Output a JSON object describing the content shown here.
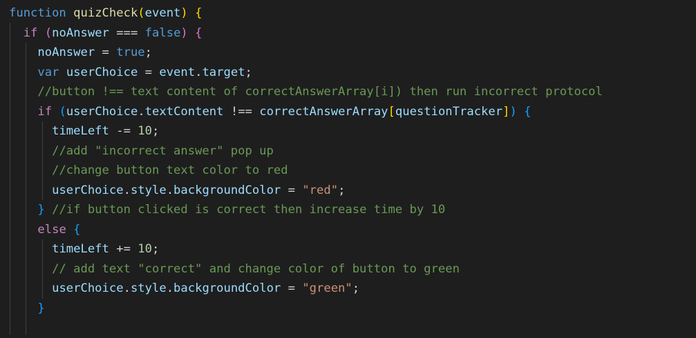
{
  "colors": {
    "background": "#1e1e1e",
    "default": "#d4d4d4",
    "keyword": "#569cd6",
    "control": "#c586c0",
    "function": "#dcdcaa",
    "variable": "#9cdcfe",
    "number": "#b5cea8",
    "string": "#ce9178",
    "comment": "#6a9955",
    "bracket_level1": "#ffd700",
    "bracket_level2": "#da70d6",
    "bracket_level3": "#179fff"
  },
  "lines": [
    [
      [
        "kw",
        "function"
      ],
      [
        "op",
        " "
      ],
      [
        "fn",
        "quizCheck"
      ],
      [
        "b1",
        "("
      ],
      [
        "var",
        "event"
      ],
      [
        "b1",
        ")"
      ],
      [
        "op",
        " "
      ],
      [
        "b1",
        "{"
      ]
    ],
    [
      [
        "op",
        "  "
      ],
      [
        "ctrl",
        "if"
      ],
      [
        "op",
        " "
      ],
      [
        "b2",
        "("
      ],
      [
        "var",
        "noAnswer"
      ],
      [
        "op",
        " === "
      ],
      [
        "kw",
        "false"
      ],
      [
        "b2",
        ")"
      ],
      [
        "op",
        " "
      ],
      [
        "b2",
        "{"
      ]
    ],
    [
      [
        "op",
        "    "
      ],
      [
        "var",
        "noAnswer"
      ],
      [
        "op",
        " = "
      ],
      [
        "kw",
        "true"
      ],
      [
        "op",
        ";"
      ]
    ],
    [
      [
        "op",
        "    "
      ],
      [
        "kw",
        "var"
      ],
      [
        "op",
        " "
      ],
      [
        "var",
        "userChoice"
      ],
      [
        "op",
        " = "
      ],
      [
        "var",
        "event"
      ],
      [
        "op",
        "."
      ],
      [
        "var",
        "target"
      ],
      [
        "op",
        ";"
      ]
    ],
    [
      [
        "op",
        "    "
      ],
      [
        "cmt",
        "//button !== text content of correctAnswerArray[i]) then run incorrect protocol"
      ]
    ],
    [
      [
        "op",
        "    "
      ],
      [
        "ctrl",
        "if"
      ],
      [
        "op",
        " "
      ],
      [
        "b3",
        "("
      ],
      [
        "var",
        "userChoice"
      ],
      [
        "op",
        "."
      ],
      [
        "var",
        "textContent"
      ],
      [
        "op",
        " !== "
      ],
      [
        "var",
        "correctAnswerArray"
      ],
      [
        "b1",
        "["
      ],
      [
        "var",
        "questionTracker"
      ],
      [
        "b1",
        "]"
      ],
      [
        "b3",
        ")"
      ],
      [
        "op",
        " "
      ],
      [
        "b3",
        "{"
      ]
    ],
    [
      [
        "op",
        "      "
      ],
      [
        "var",
        "timeLeft"
      ],
      [
        "op",
        " -= "
      ],
      [
        "num",
        "10"
      ],
      [
        "op",
        ";"
      ]
    ],
    [
      [
        "op",
        "      "
      ],
      [
        "cmt",
        "//add \"incorrect answer\" pop up"
      ]
    ],
    [
      [
        "op",
        "      "
      ],
      [
        "cmt",
        "//change button text color to red"
      ]
    ],
    [
      [
        "op",
        "      "
      ],
      [
        "var",
        "userChoice"
      ],
      [
        "op",
        "."
      ],
      [
        "var",
        "style"
      ],
      [
        "op",
        "."
      ],
      [
        "var",
        "backgroundColor"
      ],
      [
        "op",
        " = "
      ],
      [
        "str",
        "\"red\""
      ],
      [
        "op",
        ";"
      ]
    ],
    [
      [
        "op",
        "    "
      ],
      [
        "b3",
        "}"
      ],
      [
        "op",
        " "
      ],
      [
        "cmt",
        "//if button clicked is correct then increase time by 10"
      ]
    ],
    [
      [
        "op",
        "    "
      ],
      [
        "ctrl",
        "else"
      ],
      [
        "op",
        " "
      ],
      [
        "b3",
        "{"
      ]
    ],
    [
      [
        "op",
        "      "
      ],
      [
        "var",
        "timeLeft"
      ],
      [
        "op",
        " += "
      ],
      [
        "num",
        "10"
      ],
      [
        "op",
        ";"
      ]
    ],
    [
      [
        "op",
        "      "
      ],
      [
        "cmt",
        "// add text \"correct\" and change color of button to green"
      ]
    ],
    [
      [
        "op",
        "      "
      ],
      [
        "var",
        "userChoice"
      ],
      [
        "op",
        "."
      ],
      [
        "var",
        "style"
      ],
      [
        "op",
        "."
      ],
      [
        "var",
        "backgroundColor"
      ],
      [
        "op",
        " = "
      ],
      [
        "str",
        "\"green\""
      ],
      [
        "op",
        ";"
      ]
    ],
    [
      [
        "op",
        "    "
      ],
      [
        "b3",
        "}"
      ]
    ],
    [
      [
        "op",
        ""
      ]
    ]
  ]
}
